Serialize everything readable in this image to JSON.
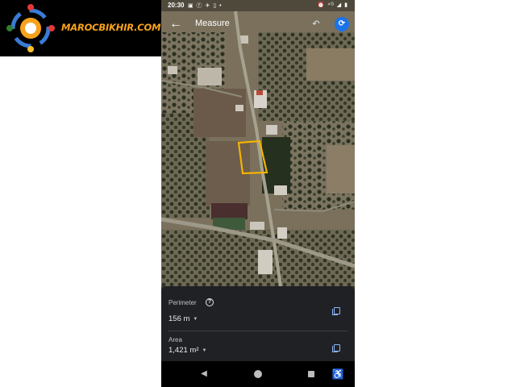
{
  "watermark": {
    "text": "MAROCBIKHIR.COM"
  },
  "status_bar": {
    "time": "20:30",
    "notification_icons": "▣ ⓕ ✈ ▯ •",
    "system_icons": "⏰ ⁴ᴳ ◢ ▮"
  },
  "app_bar": {
    "title": "Measure",
    "back_icon": "arrow-left-icon",
    "undo_icon": "undo-icon",
    "refresh_icon": "refresh-icon"
  },
  "measurement": {
    "perimeter_label": "Perimeter",
    "perimeter_value": "156 m",
    "area_label": "Area",
    "area_value": "1,421 m²"
  },
  "colors": {
    "selection_outline": "#f4b400",
    "sheet_bg": "#202124",
    "accent_blue": "#1a73e8"
  },
  "nav_bar": {
    "icons": [
      "back-triangle-icon",
      "home-circle-icon",
      "recents-square-icon",
      "accessibility-icon"
    ]
  }
}
